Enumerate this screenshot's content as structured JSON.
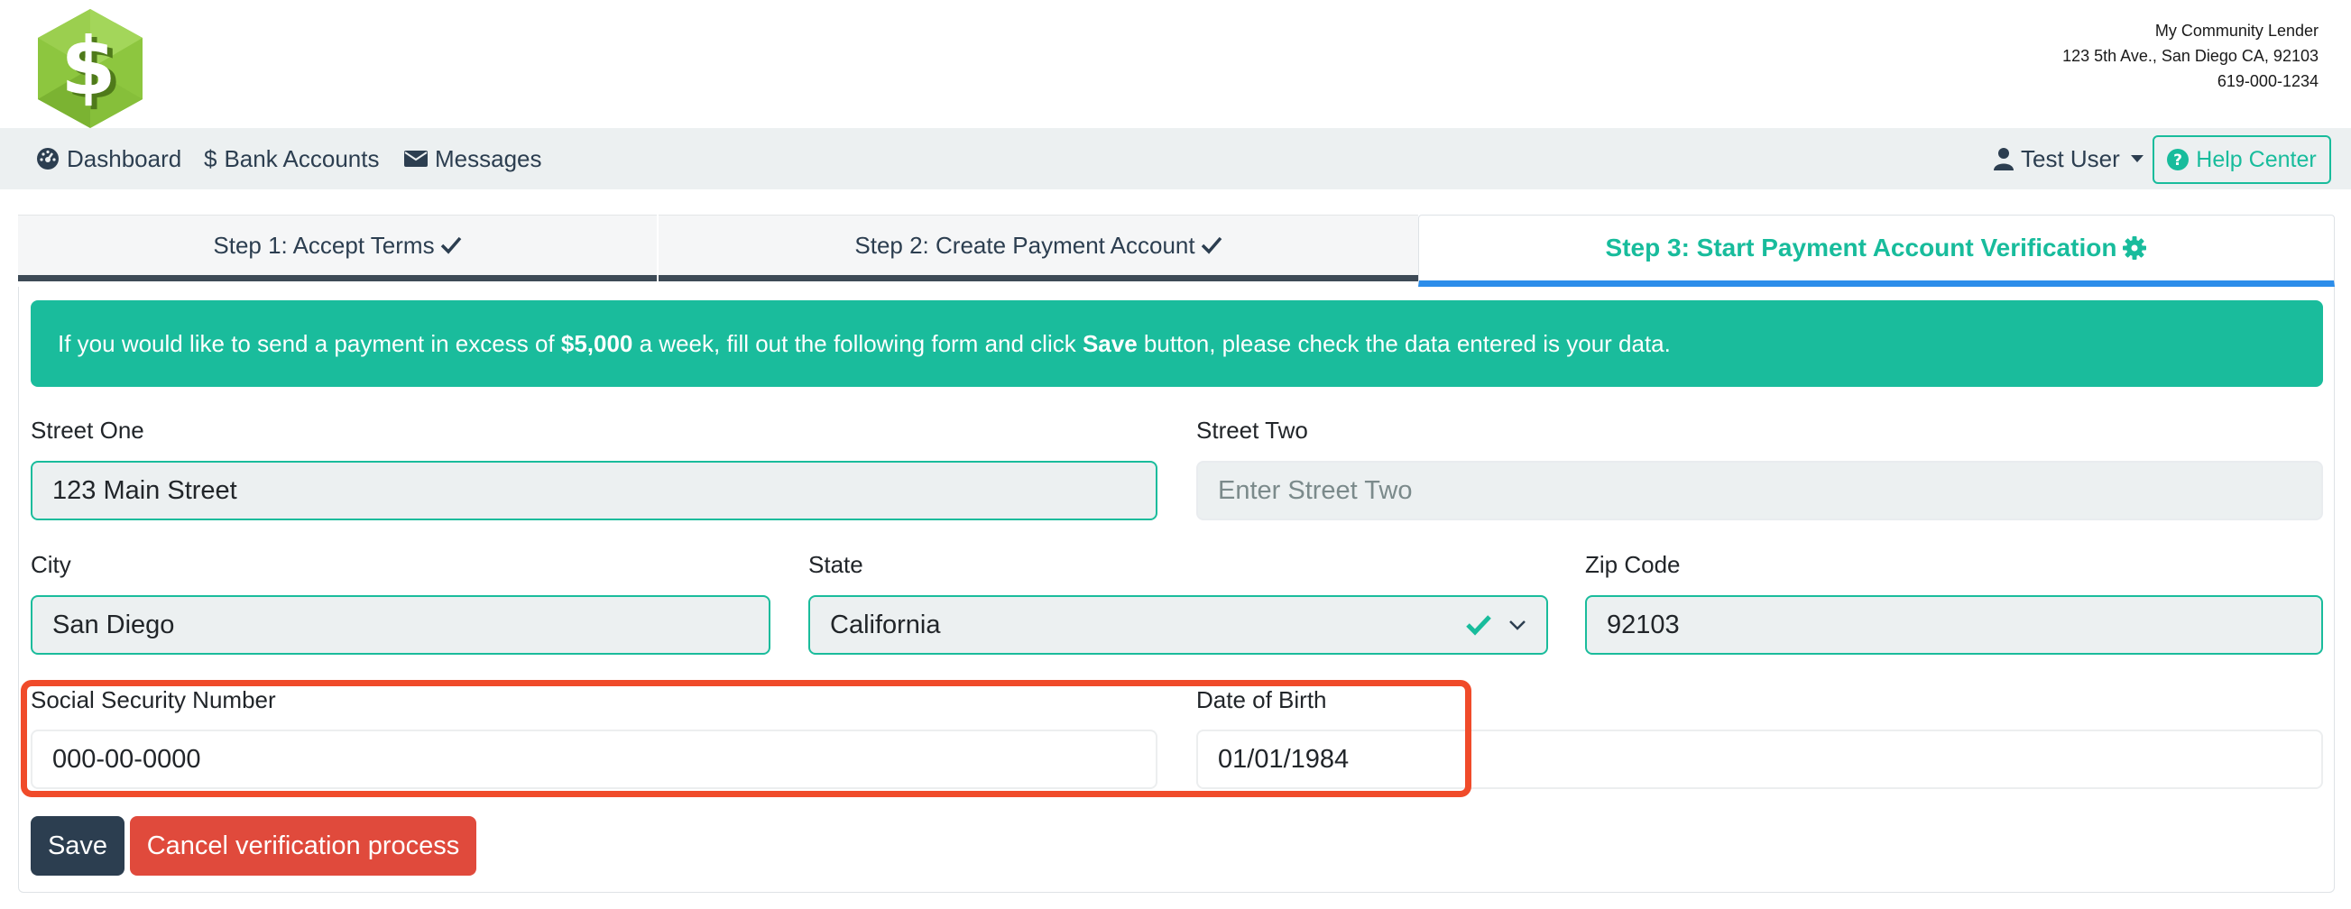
{
  "lender": {
    "name": "My Community Lender",
    "address": "123 5th Ave., San Diego CA, 92103",
    "phone": "619-000-1234"
  },
  "logo": {
    "icon": "dollar-hexagon-logo",
    "color": "#8dc63f"
  },
  "nav": {
    "dashboard": "Dashboard",
    "bank_accounts": "Bank Accounts",
    "messages": "Messages",
    "user": "Test User",
    "help": "Help Center"
  },
  "steps": [
    {
      "label": "Step 1: Accept Terms",
      "icon": "check-icon"
    },
    {
      "label": "Step 2: Create Payment Account",
      "icon": "check-icon"
    },
    {
      "label": "Step 3: Start Payment Account Verification",
      "icon": "gear-icon"
    }
  ],
  "alert": {
    "part1": "If you would like to send a payment in excess of ",
    "amount": "$5,000",
    "part2": " a week, fill out the following form and click ",
    "save_word": "Save",
    "part3": " button, please check the data entered is your data."
  },
  "form": {
    "street_one": {
      "label": "Street One",
      "value": "123 Main Street"
    },
    "street_two": {
      "label": "Street Two",
      "placeholder": "Enter Street Two"
    },
    "city": {
      "label": "City",
      "value": "San Diego"
    },
    "state": {
      "label": "State",
      "value": "California"
    },
    "zip": {
      "label": "Zip Code",
      "value": "92103"
    },
    "ssn": {
      "label": "Social Security Number",
      "value": "000-00-0000"
    },
    "dob": {
      "label": "Date of Birth",
      "value": "01/01/1984"
    }
  },
  "buttons": {
    "save": "Save",
    "cancel": "Cancel verification process"
  },
  "colors": {
    "primary": "#2c3e50",
    "success": "#18bc9c",
    "danger": "#e04a3c",
    "active_tab": "#2c8dea",
    "highlight": "#f04b2a"
  }
}
